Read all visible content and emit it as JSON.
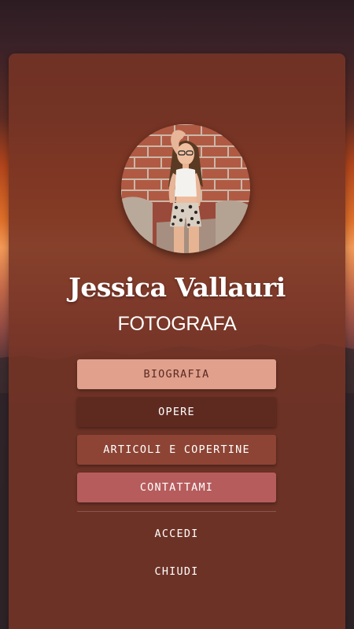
{
  "profile": {
    "name": "Jessica Vallauri",
    "role": "FOTOGRAFA",
    "photo_icon": "profile-photo"
  },
  "menu": {
    "items": [
      {
        "label": "BIOGRAFIA",
        "color": "#e0a08c"
      },
      {
        "label": "OPERE",
        "color": "#5e2a20"
      },
      {
        "label": "ARTICOLI E COPERTINE",
        "color": "#8d4434"
      },
      {
        "label": "CONTATTAMI",
        "color": "#b65c5c"
      }
    ]
  },
  "footer_links": {
    "login": "ACCEDI",
    "close": "CHIUDI"
  },
  "colors": {
    "panel": "#763426",
    "sunset": "#f49a58"
  }
}
